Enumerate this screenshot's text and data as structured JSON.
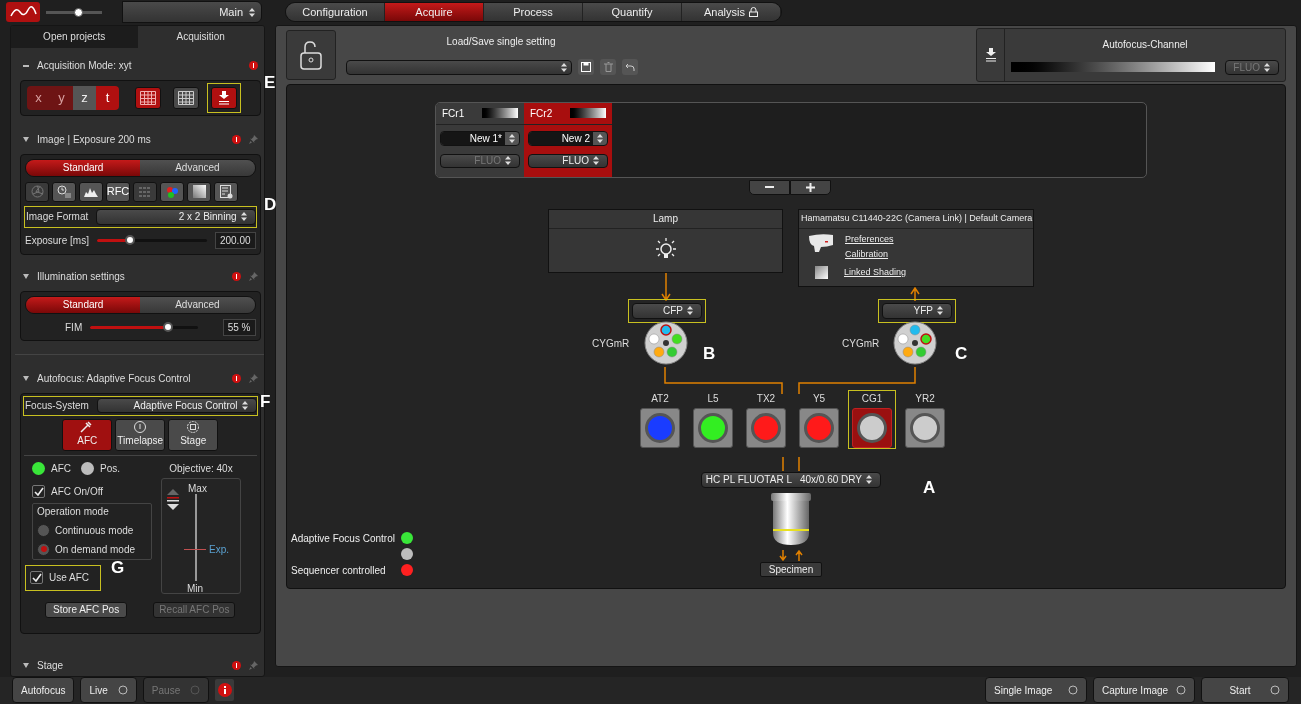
{
  "header": {
    "workspace": "Main"
  },
  "workflow_tabs": [
    {
      "label": "Configuration",
      "selected": false,
      "locked": false
    },
    {
      "label": "Acquire",
      "selected": true,
      "locked": false
    },
    {
      "label": "Process",
      "selected": false,
      "locked": false
    },
    {
      "label": "Quantify",
      "selected": false,
      "locked": false
    },
    {
      "label": "Analysis",
      "selected": false,
      "locked": true
    }
  ],
  "left_tabs": [
    {
      "label": "Open projects",
      "selected": false
    },
    {
      "label": "Acquisition",
      "selected": true
    }
  ],
  "acquisition_mode": {
    "title": "Acquisition Mode: xyt",
    "axes": [
      {
        "label": "x",
        "selected": true
      },
      {
        "label": "y",
        "selected": true
      },
      {
        "label": "z",
        "selected": false
      },
      {
        "label": "t",
        "selected": true
      }
    ],
    "mode_buttons": [
      {
        "selected": true,
        "highlighted": false
      },
      {
        "selected": false,
        "highlighted": false
      },
      {
        "selected": true,
        "highlighted": true
      }
    ]
  },
  "image": {
    "title": "Image | Exposure 200 ms",
    "modes": [
      {
        "label": "Standard",
        "selected": true
      },
      {
        "label": "Advanced",
        "selected": false
      }
    ],
    "tools": [
      {
        "kind": "icon",
        "disabled": true
      },
      {
        "kind": "icon",
        "disabled": false
      },
      {
        "kind": "icon",
        "disabled": false
      },
      {
        "kind": "text",
        "label": "RFC",
        "disabled": false
      },
      {
        "kind": "icon",
        "disabled": true
      },
      {
        "kind": "icon",
        "disabled": false
      },
      {
        "kind": "icon",
        "disabled": false
      },
      {
        "kind": "icon",
        "disabled": false
      }
    ],
    "image_format": {
      "label": "Image Format",
      "value": "2 x 2 Binning",
      "highlighted": true
    },
    "exposure": {
      "label": "Exposure [ms]",
      "level": 0.3,
      "reading": "200.00"
    }
  },
  "illumination": {
    "title": "Illumination settings",
    "modes": [
      {
        "label": "Standard",
        "selected": true
      },
      {
        "label": "Advanced",
        "selected": false
      }
    ],
    "fim": {
      "label": "FIM",
      "level": 0.72,
      "reading": "55 %"
    }
  },
  "autofocus": {
    "title": "Autofocus: Adaptive Focus Control",
    "focus_system": {
      "label": "Focus-System",
      "value": "Adaptive Focus Control",
      "highlighted": true
    },
    "tabs": [
      {
        "label": "AFC",
        "selected": true
      },
      {
        "label": "Timelapse",
        "selected": false
      },
      {
        "label": "Stage",
        "selected": false
      }
    ],
    "indicators": [
      {
        "label": "AFC",
        "color": "#39e639"
      },
      {
        "label": "Pos.",
        "color": "#bdbdbd"
      }
    ],
    "afc_on_off": {
      "label": "AFC On/Off",
      "checked": true
    },
    "operation_mode": {
      "title": "Operation mode",
      "options": [
        {
          "label": "Continuous mode",
          "selected": false
        },
        {
          "label": "On demand mode",
          "selected": true
        }
      ]
    },
    "use_afc": {
      "label": "Use AFC",
      "checked": true,
      "highlighted": true
    },
    "objective": {
      "title": "Objective: 40x",
      "max": "Max",
      "exp": "Exp.",
      "min": "Min"
    },
    "buttons": [
      {
        "label": "Store AFC Pos",
        "disabled": false
      },
      {
        "label": "Recall AFC Pos",
        "disabled": true
      }
    ]
  },
  "stage": {
    "title": "Stage"
  },
  "settings": {
    "title": "Load/Save single setting"
  },
  "autofocus_channel": {
    "title": "Autofocus-Channel",
    "mode": "FLUO"
  },
  "channels": [
    {
      "name": "FCr1",
      "selected": false,
      "setting": "New 1*",
      "mode": "FLUO",
      "disabled": true
    },
    {
      "name": "FCr2",
      "selected": true,
      "setting": "New 2",
      "mode": "FLUO",
      "disabled": false
    }
  ],
  "lamp": {
    "title": "Lamp"
  },
  "camera": {
    "title": "Hamamatsu C11440-22C (Camera Link) | Default Camera",
    "links": [
      "Preferences",
      "Calibration",
      "Linked Shading"
    ]
  },
  "filter_wheels": [
    {
      "value": "CFP",
      "label": "CYGmR",
      "highlighted": true
    },
    {
      "value": "YFP",
      "label": "CYGmR",
      "highlighted": true
    }
  ],
  "filter_cubes": [
    {
      "label": "AT2",
      "color": "#1a3cff",
      "selected": false
    },
    {
      "label": "L5",
      "color": "#33ee22",
      "selected": false
    },
    {
      "label": "TX2",
      "color": "#ff1a1a",
      "selected": false
    },
    {
      "label": "Y5",
      "color": "#ff1a1a",
      "selected": false
    },
    {
      "label": "CG1",
      "color": "#cccccc",
      "selected": true
    },
    {
      "label": "YR2",
      "color": "#cccccc",
      "selected": false
    }
  ],
  "objective": {
    "value": "HC PL FLUOTAR L   40x/0.60 DRY",
    "specimen": "Specimen"
  },
  "legend": [
    {
      "label": "Adaptive Focus Control",
      "color": "#39e639"
    },
    {
      "color": "#bdbdbd"
    },
    {
      "label": "Sequencer controlled",
      "color": "#ff2020"
    }
  ],
  "callouts": [
    "E",
    "D",
    "F",
    "G",
    "B",
    "C",
    "A"
  ],
  "bottom_left": [
    {
      "label": "Autofocus",
      "kind": "plain",
      "disabled": false
    },
    {
      "label": "Live",
      "kind": "toggle",
      "disabled": false
    },
    {
      "label": "Pause",
      "kind": "toggle",
      "disabled": true
    }
  ],
  "bottom_right": [
    {
      "label": "Single Image"
    },
    {
      "label": "Capture Image"
    },
    {
      "label": "Start"
    }
  ]
}
